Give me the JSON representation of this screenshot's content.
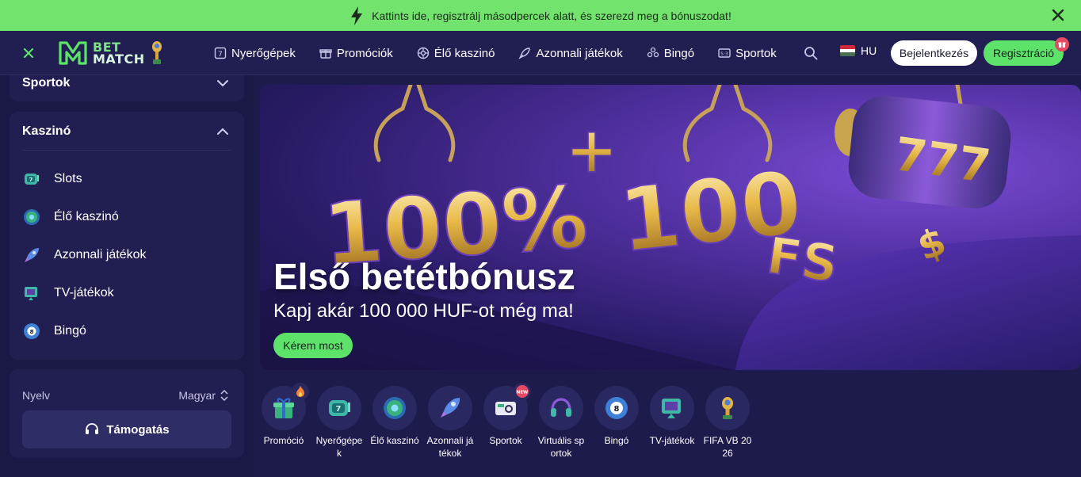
{
  "promo_bar": {
    "text": "Kattints ide, regisztrálj másodpercek alatt, és szerezd meg a bónuszodat!"
  },
  "header": {
    "logo": {
      "line1": "BET",
      "line2": "MATCH"
    },
    "nav": [
      {
        "label": "Nyerőgépek",
        "icon": "slot-icon"
      },
      {
        "label": "Promóciók",
        "icon": "gift-icon"
      },
      {
        "label": "Élő kaszinó",
        "icon": "roulette-icon"
      },
      {
        "label": "Azonnali játékok",
        "icon": "rocket-icon"
      },
      {
        "label": "Bingó",
        "icon": "bingo-icon"
      },
      {
        "label": "Sportok",
        "icon": "scoreboard-icon"
      }
    ],
    "language": "HU",
    "login_label": "Bejelentkezés",
    "register_label": "Regisztráció",
    "colors": {
      "accent": "#5ee36a",
      "header_bg": "#211f52",
      "promo_bg": "#72e36c"
    }
  },
  "sidebar": {
    "sports": {
      "title": "Sportok"
    },
    "casino": {
      "title": "Kaszinó",
      "items": [
        {
          "label": "Slots",
          "icon": "slot-machine-icon"
        },
        {
          "label": "Élő kaszinó",
          "icon": "roulette-icon"
        },
        {
          "label": "Azonnali játékok",
          "icon": "rocket-icon"
        },
        {
          "label": "TV-játékok",
          "icon": "tv-icon"
        },
        {
          "label": "Bingó",
          "icon": "bingo-ball-icon"
        }
      ]
    },
    "language_label": "Nyelv",
    "language_value": "Magyar",
    "support_label": "Támogatás"
  },
  "banner": {
    "title": "Első betétbónusz",
    "subtitle": "Kapj akár 100 000 HUF-ot még ma!",
    "cta": "Kérem most",
    "art": {
      "line1": "100%",
      "plus": "+",
      "line2": "100",
      "fs": "FS",
      "reels": "777",
      "dollar": "$"
    }
  },
  "categories": [
    {
      "label": "Promóció",
      "icon": "gift-icon",
      "badge": "fire-icon"
    },
    {
      "label": "Nyerőgépek",
      "icon": "slot-machine-icon"
    },
    {
      "label": "Élő kaszinó",
      "icon": "roulette-icon"
    },
    {
      "label": "Azonnali játékok",
      "icon": "rocket-icon"
    },
    {
      "label": "Sportok",
      "icon": "ticket-icon",
      "badge": "new-icon",
      "badge_text": "NEW"
    },
    {
      "label": "Virtuális sportok",
      "icon": "headset-icon"
    },
    {
      "label": "Bingó",
      "icon": "bingo-ball-icon"
    },
    {
      "label": "TV-játékok",
      "icon": "tv-icon"
    },
    {
      "label": "FIFA VB 2026",
      "icon": "trophy-icon"
    }
  ]
}
